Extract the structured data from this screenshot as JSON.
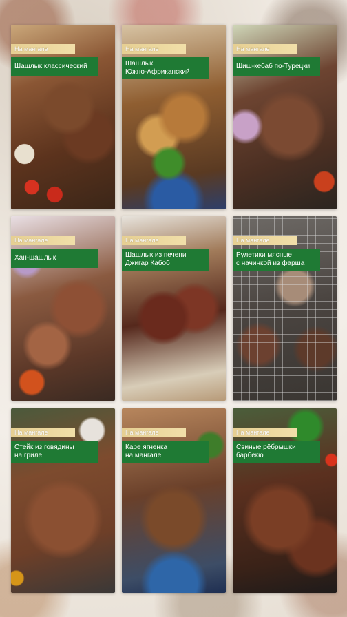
{
  "tag_label": "На мангале",
  "cards": [
    {
      "title": "Шашлык классический"
    },
    {
      "title": "Шашлык\nЮжно-Африканский"
    },
    {
      "title": "Шиш-кебаб по-Турецки"
    },
    {
      "title": "Хан-шашлык"
    },
    {
      "title": "Шашлык из печени\nДжигар Кабоб"
    },
    {
      "title": "Рулетики мясные\nс начинкой из фарша"
    },
    {
      "title": "Стейк из говядины\nна гриле"
    },
    {
      "title": "Каре ягненка\nна мангале"
    },
    {
      "title": "Свиные рёбрышки\nбарбекю"
    }
  ],
  "colors": {
    "title_bg": "#1f7a34",
    "tag_bg": "#e6cf92"
  }
}
